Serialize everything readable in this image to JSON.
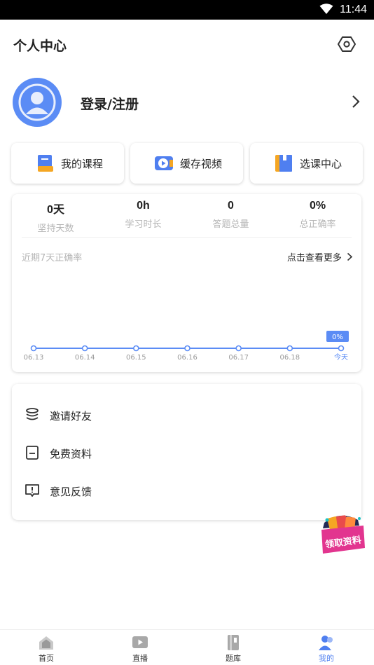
{
  "status_bar": {
    "time": "11:44"
  },
  "header": {
    "title": "个人中心"
  },
  "profile": {
    "login_label": "登录/注册"
  },
  "quick_actions": [
    {
      "label": "我的课程",
      "icon": "course-book-icon"
    },
    {
      "label": "缓存视频",
      "icon": "video-cache-icon"
    },
    {
      "label": "选课中心",
      "icon": "course-center-icon"
    }
  ],
  "stats": [
    {
      "value": "0天",
      "label": "坚持天数"
    },
    {
      "value": "0h",
      "label": "学习时长"
    },
    {
      "value": "0",
      "label": "答题总量"
    },
    {
      "value": "0%",
      "label": "总正确率"
    }
  ],
  "chart": {
    "title": "近期7天正确率",
    "more_label": "点击查看更多"
  },
  "chart_data": {
    "type": "line",
    "title": "近期7天正确率",
    "categories": [
      "06.13",
      "06.14",
      "06.15",
      "06.16",
      "06.17",
      "06.18",
      "今天"
    ],
    "values": [
      0,
      0,
      0,
      0,
      0,
      0,
      0
    ],
    "highlight_label": "0%",
    "color": "#5b8cf5"
  },
  "menu": [
    {
      "label": "邀请好友",
      "icon": "stack-coins-icon"
    },
    {
      "label": "免费资料",
      "icon": "document-icon"
    },
    {
      "label": "意见反馈",
      "icon": "feedback-icon"
    }
  ],
  "promo": {
    "label": "领取资料"
  },
  "tabbar": [
    {
      "label": "首页",
      "icon": "home-icon",
      "active": false
    },
    {
      "label": "直播",
      "icon": "live-play-icon",
      "active": false
    },
    {
      "label": "题库",
      "icon": "question-bank-icon",
      "active": false
    },
    {
      "label": "我的",
      "icon": "user-profile-icon",
      "active": true
    }
  ],
  "colors": {
    "accent": "#5b8cf5",
    "active_tab": "#4f7ff0"
  }
}
